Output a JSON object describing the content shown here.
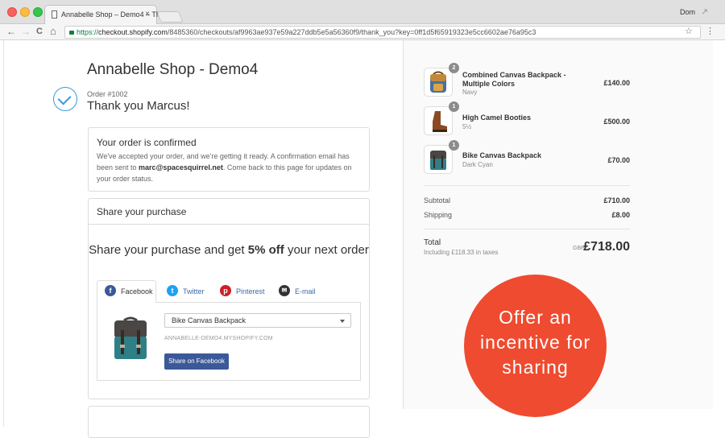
{
  "browser": {
    "tab_title": "Annabelle Shop – Demo4 – Th",
    "tab_close": "×",
    "user": "Dom",
    "url_scheme": "https://",
    "url_host": "checkout.shopify.com",
    "url_path": "/8485360/checkouts/af9963ae937e59a227ddb5e5a56360f9/thank_you?key=0ff1d5f65919323e5cc6602ae76a95c3",
    "back_glyph": "←",
    "forward_glyph": "→",
    "reload_glyph": "C",
    "home_glyph": "⌂",
    "star_glyph": "☆",
    "menu_glyph": "⋮",
    "resize_glyph": "↗"
  },
  "colors": {
    "close": "#fc605c",
    "minimize": "#fdbc40",
    "zoom": "#34c84a",
    "accent_check": "#3a9ad9",
    "facebook": "#3b5998",
    "twitter": "#1da1f2",
    "pinterest": "#cb2027",
    "email": "#333333",
    "callout": "#ef4b30"
  },
  "header": {
    "shop_name": "Annabelle Shop - Demo4",
    "order_number": "Order #1002",
    "thank_you": "Thank you Marcus!"
  },
  "confirmation": {
    "title": "Your order is confirmed",
    "text_before": "We've accepted your order, and we're getting it ready. A confirmation email has been sent to ",
    "email": "marc@spacesquirrel.net",
    "text_after": ". Come back to this page for updates on your order status."
  },
  "share": {
    "section_title": "Share your purchase",
    "headline_before": "Share your purchase and get ",
    "headline_bold": "5% off",
    "headline_after": " your next order",
    "tabs": [
      {
        "label": "Facebook",
        "icon": "facebook-icon",
        "glyph": "f"
      },
      {
        "label": "Twitter",
        "icon": "twitter-icon",
        "glyph": "t"
      },
      {
        "label": "Pinterest",
        "icon": "pinterest-icon",
        "glyph": "p"
      },
      {
        "label": "E-mail",
        "icon": "email-icon",
        "glyph": "✉"
      }
    ],
    "selected_product": "Bike Canvas Backpack",
    "store_url": "ANNABELLE-DEMO4.MYSHOPIFY.COM",
    "button_label": "Share on Facebook"
  },
  "summary": {
    "items": [
      {
        "qty": "2",
        "name": "Combined Canvas Backpack - Multiple Colors",
        "variant": "Navy",
        "price": "£140.00"
      },
      {
        "qty": "1",
        "name": "High Camel Booties",
        "variant": "5½",
        "price": "£500.00"
      },
      {
        "qty": "1",
        "name": "Bike Canvas Backpack",
        "variant": "Dark Cyan",
        "price": "£70.00"
      }
    ],
    "subtotal_label": "Subtotal",
    "subtotal": "£710.00",
    "shipping_label": "Shipping",
    "shipping": "£8.00",
    "total_label": "Total",
    "taxes_note": "Including £118.33 in taxes",
    "currency": "GBP",
    "total": "£718.00"
  },
  "callout": {
    "line1": "Offer an",
    "line2": "incentive for",
    "line3": "sharing"
  }
}
